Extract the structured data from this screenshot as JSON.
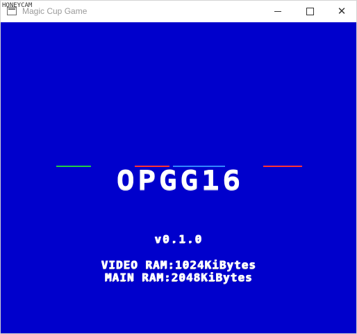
{
  "watermark": "HONEYCAM",
  "window": {
    "title": "Magic Cup Game",
    "controls": {
      "minimize": "minimize",
      "maximize": "maximize",
      "close": "✕"
    }
  },
  "game": {
    "background_color": "#0000cc",
    "logo": "OPGG16",
    "logo_accent_colors": [
      "#22cc44",
      "#ff3333",
      "#3388ff"
    ],
    "version": "v0.1.0",
    "video_ram": "VIDEO RAM:1024KiBytes",
    "main_ram": "MAIN RAM:2048KiBytes"
  }
}
